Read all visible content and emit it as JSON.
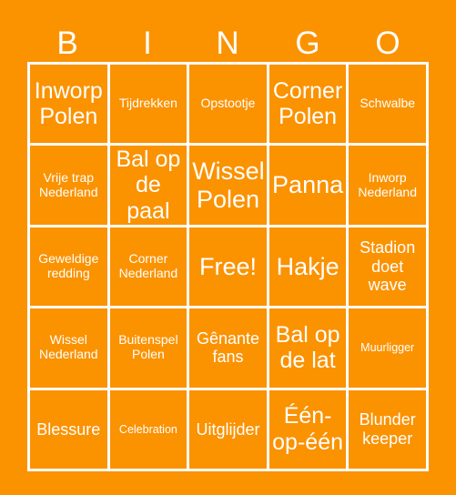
{
  "theme": {
    "background_color": "#fb9200",
    "grid_line_color": "#ffffff",
    "text_color": "#ffffff"
  },
  "header": {
    "letters": [
      "B",
      "I",
      "N",
      "G",
      "O"
    ]
  },
  "grid": {
    "columns": 5,
    "rows": 5,
    "cells": [
      [
        {
          "text": "Inworp Polen",
          "size": "lg"
        },
        {
          "text": "Tijdrekken",
          "size": "sm"
        },
        {
          "text": "Opstootje",
          "size": "sm"
        },
        {
          "text": "Corner Polen",
          "size": "lg"
        },
        {
          "text": "Schwalbe",
          "size": "sm"
        }
      ],
      [
        {
          "text": "Vrije trap Nederland",
          "size": "sm"
        },
        {
          "text": "Bal op de paal",
          "size": "lg"
        },
        {
          "text": "Wissel Polen",
          "size": "xl"
        },
        {
          "text": "Panna",
          "size": "xl"
        },
        {
          "text": "Inworp Nederland",
          "size": "sm"
        }
      ],
      [
        {
          "text": "Geweldige redding",
          "size": "sm"
        },
        {
          "text": "Corner Nederland",
          "size": "sm"
        },
        {
          "text": "Free!",
          "size": "xl"
        },
        {
          "text": "Hakje",
          "size": "xl"
        },
        {
          "text": "Stadion doet wave",
          "size": "md"
        }
      ],
      [
        {
          "text": "Wissel Nederland",
          "size": "sm"
        },
        {
          "text": "Buitenspel Polen",
          "size": "sm"
        },
        {
          "text": "Gênante fans",
          "size": "md"
        },
        {
          "text": "Bal op de lat",
          "size": "lg"
        },
        {
          "text": "Muurligger",
          "size": "xs"
        }
      ],
      [
        {
          "text": "Blessure",
          "size": "md"
        },
        {
          "text": "Celebration",
          "size": "xs"
        },
        {
          "text": "Uitglijder",
          "size": "md"
        },
        {
          "text": "Één-op-één",
          "size": "lg"
        },
        {
          "text": "Blunder keeper",
          "size": "md"
        }
      ]
    ]
  }
}
